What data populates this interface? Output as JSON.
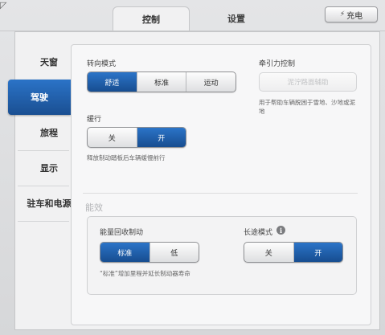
{
  "window": {
    "corner_glyph": "◸"
  },
  "tabs": [
    {
      "label": "控制",
      "active": true
    },
    {
      "label": "设置",
      "active": false
    }
  ],
  "charge_button": {
    "icon": "plug-icon",
    "label": "充电"
  },
  "sidebar": {
    "items": [
      {
        "label": "天窗",
        "active": false
      },
      {
        "label": "驾驶",
        "active": true
      },
      {
        "label": "旅程",
        "active": false
      },
      {
        "label": "显示",
        "active": false
      },
      {
        "label": "驻车和电源",
        "active": false
      }
    ]
  },
  "steering": {
    "title": "转向模式",
    "options": [
      "舒适",
      "标准",
      "运动"
    ],
    "selected": "舒适"
  },
  "traction": {
    "title": "牵引力控制",
    "button_label": "泥泞路面辅助",
    "hint": "用于帮助车辆脱困于雪地、沙地或泥地"
  },
  "creep": {
    "title": "缓行",
    "options": [
      "关",
      "开"
    ],
    "selected": "开",
    "hint": "释放制动踏板后车辆缓慢前行"
  },
  "efficiency": {
    "section_title": "能效",
    "regen": {
      "title": "能量回收制动",
      "options": [
        "标准",
        "低"
      ],
      "selected": "标准",
      "hint": "“标准”增加里程并延长制动器寿命"
    },
    "range_mode": {
      "title": "长途模式",
      "info_icon": "i",
      "options": [
        "关",
        "开"
      ],
      "selected": "开"
    }
  },
  "colors": {
    "accent": "#1f5fad",
    "panel": "#f1f1f2",
    "background": "#d9dadc"
  }
}
